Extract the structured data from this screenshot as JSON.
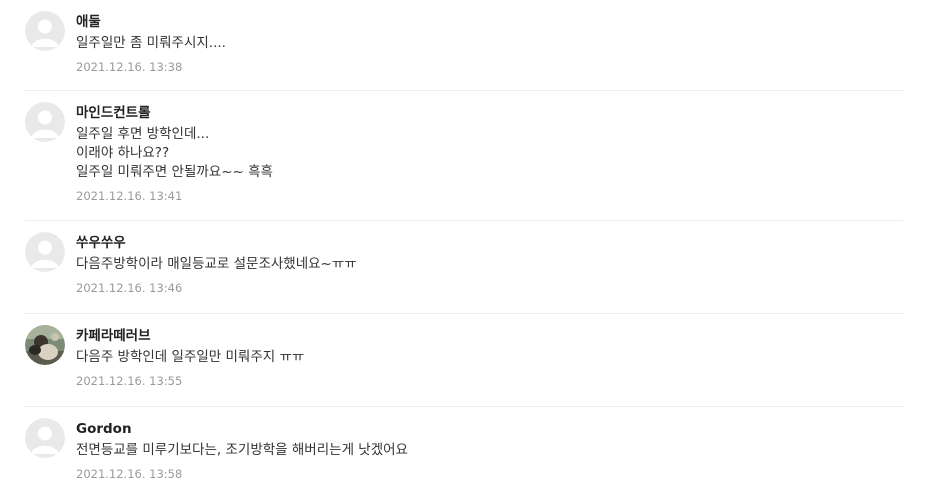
{
  "comments": [
    {
      "author": "애둘",
      "lines": [
        "일주일만 좀 미뤄주시지...."
      ],
      "date": "2021.12.16. 13:38",
      "avatar": "default"
    },
    {
      "author": "마인드컨트롤",
      "lines": [
        "일주일 후면 방학인데...",
        "이래야 하나요??",
        "일주일 미뤄주면 안될까요~~ 흑흑"
      ],
      "date": "2021.12.16. 13:41",
      "avatar": "default"
    },
    {
      "author": "쑤우쑤우",
      "lines": [
        "다음주방학이라 매일등교로 설문조사했네요~ㅠㅠ"
      ],
      "date": "2021.12.16. 13:46",
      "avatar": "default"
    },
    {
      "author": "카페라떼러브",
      "lines": [
        "다음주 방학인데 일주일만 미뤄주지 ㅠㅠ"
      ],
      "date": "2021.12.16. 13:55",
      "avatar": "photo"
    },
    {
      "author": "Gordon",
      "lines": [
        "전면등교를 미루기보다는, 조기방학을 해버리는게 낫겠어요"
      ],
      "date": "2021.12.16. 13:58",
      "avatar": "default"
    }
  ]
}
